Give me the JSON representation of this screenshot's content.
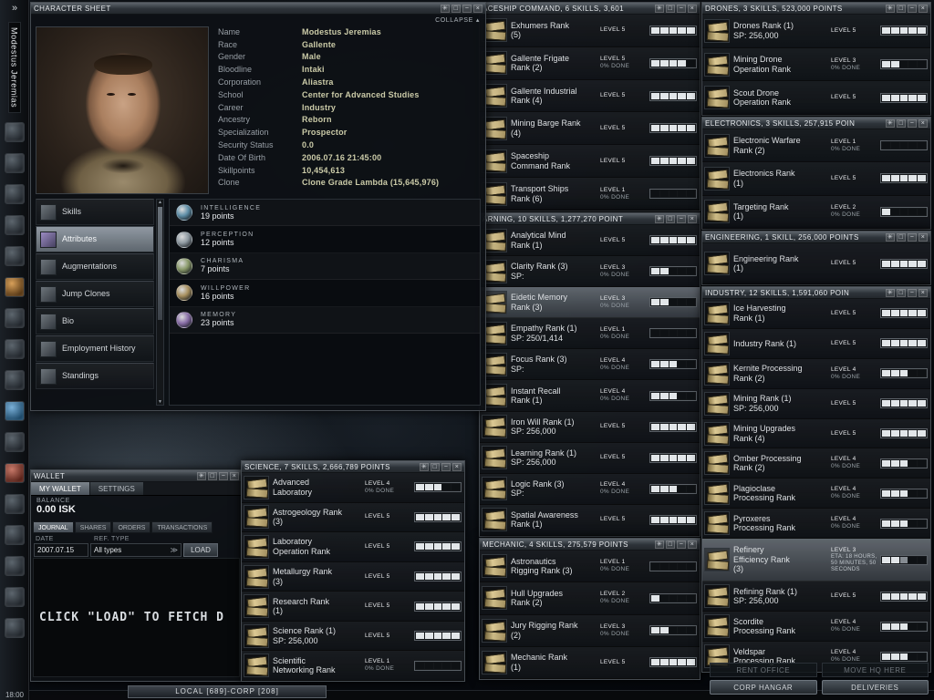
{
  "window_controls": [
    "✳",
    "□",
    "−",
    "×"
  ],
  "icons": {
    "collapse_arrow": "▴",
    "select_chevrons": "≫",
    "scroll_up": "▲",
    "scroll_down": "▼"
  },
  "sidebar": {
    "expander": "»",
    "character_name": "Modestus Jeremias",
    "time": "18:00",
    "icons": [
      "character",
      "map",
      "mail",
      "wallet",
      "market",
      "assets",
      "fitting",
      "cargo",
      "science",
      "corporation",
      "agents",
      "journal",
      "help",
      "settings",
      "people",
      "places",
      "log"
    ]
  },
  "character_sheet": {
    "title": "CHARACTER SHEET",
    "collapse_label": "COLLAPSE",
    "fields": [
      {
        "label": "Name",
        "value": "Modestus Jeremias"
      },
      {
        "label": "Race",
        "value": "Gallente"
      },
      {
        "label": "Gender",
        "value": "Male"
      },
      {
        "label": "Bloodline",
        "value": "Intaki"
      },
      {
        "label": "Corporation",
        "value": "Aliastra"
      },
      {
        "label": "School",
        "value": "Center for Advanced Studies"
      },
      {
        "label": "Career",
        "value": "Industry"
      },
      {
        "label": "Ancestry",
        "value": "Reborn"
      },
      {
        "label": "Specialization",
        "value": "Prospector"
      },
      {
        "label": "Security Status",
        "value": "0.0"
      },
      {
        "label": "Date Of Birth",
        "value": "2006.07.16 21:45:00"
      },
      {
        "label": "Skillpoints",
        "value": "10,454,613"
      },
      {
        "label": "Clone",
        "value": "Clone Grade Lambda (15,645,976)"
      }
    ],
    "nav": [
      {
        "label": "Skills",
        "selected": false
      },
      {
        "label": "Attributes",
        "selected": true
      },
      {
        "label": "Augmentations",
        "selected": false
      },
      {
        "label": "Jump Clones",
        "selected": false
      },
      {
        "label": "Bio",
        "selected": false
      },
      {
        "label": "Employment History",
        "selected": false
      },
      {
        "label": "Standings",
        "selected": false
      }
    ],
    "attributes": [
      {
        "name": "INTELLIGENCE",
        "points": "19 points",
        "icon_color": "#5f8fa8"
      },
      {
        "name": "PERCEPTION",
        "points": "12 points",
        "icon_color": "#8f9aa2"
      },
      {
        "name": "CHARISMA",
        "points": "7 points",
        "icon_color": "#8a9a6a"
      },
      {
        "name": "WILLPOWER",
        "points": "16 points",
        "icon_color": "#a8905f"
      },
      {
        "name": "MEMORY",
        "points": "23 points",
        "icon_color": "#8a6fa8"
      }
    ]
  },
  "skill_windows": [
    {
      "id": "spaceship",
      "title": "ACESHIP COMMAND, 6 SKILLS, 3,601",
      "skills": [
        {
          "lines": [
            "Exhumers Rank",
            "(5)"
          ],
          "level": "LEVEL 5",
          "done": "",
          "filled": 5
        },
        {
          "lines": [
            "Gallente Frigate",
            "Rank (2)"
          ],
          "level": "LEVEL 5",
          "done": "0% DONE",
          "filled": 4
        },
        {
          "lines": [
            "Gallente Industrial",
            "Rank (4)"
          ],
          "level": "LEVEL 5",
          "done": "",
          "filled": 5
        },
        {
          "lines": [
            "Mining Barge Rank",
            "(4)"
          ],
          "level": "LEVEL 5",
          "done": "",
          "filled": 5
        },
        {
          "lines": [
            "Spaceship",
            "Command Rank"
          ],
          "level": "LEVEL 5",
          "done": "",
          "filled": 5
        },
        {
          "lines": [
            "Transport Ships",
            "Rank (6)"
          ],
          "level": "LEVEL 1",
          "done": "0% DONE",
          "filled": 0
        }
      ]
    },
    {
      "id": "learning",
      "title": "ARNING, 10 SKILLS, 1,277,270 POINT",
      "skills": [
        {
          "lines": [
            "Analytical Mind",
            "Rank (1)"
          ],
          "level": "LEVEL 5",
          "done": "",
          "filled": 5
        },
        {
          "lines": [
            "Clarity Rank (3)",
            "SP:"
          ],
          "level": "LEVEL 3",
          "done": "0% DONE",
          "filled": 2
        },
        {
          "lines": [
            "Eidetic Memory",
            "Rank (3)"
          ],
          "level": "LEVEL 3",
          "done": "0% DONE",
          "filled": 2,
          "highlight": true
        },
        {
          "lines": [
            "Empathy Rank (1)",
            "SP: 250/1,414"
          ],
          "level": "LEVEL 1",
          "done": "0% DONE",
          "filled": 0
        },
        {
          "lines": [
            "Focus Rank (3)",
            "SP:"
          ],
          "level": "LEVEL 4",
          "done": "0% DONE",
          "filled": 3
        },
        {
          "lines": [
            "Instant Recall",
            "Rank (1)"
          ],
          "level": "LEVEL 4",
          "done": "0% DONE",
          "filled": 3
        },
        {
          "lines": [
            "Iron Will Rank (1)",
            "SP: 256,000"
          ],
          "level": "LEVEL 5",
          "done": "",
          "filled": 5
        },
        {
          "lines": [
            "Learning Rank (1)",
            "SP: 256,000"
          ],
          "level": "LEVEL 5",
          "done": "",
          "filled": 5
        },
        {
          "lines": [
            "Logic Rank (3)",
            "SP:"
          ],
          "level": "LEVEL 4",
          "done": "0% DONE",
          "filled": 3
        },
        {
          "lines": [
            "Spatial Awareness",
            "Rank (1)"
          ],
          "level": "LEVEL 5",
          "done": "",
          "filled": 5
        }
      ]
    },
    {
      "id": "mechanic",
      "title": "MECHANIC, 4 SKILLS, 275,579 POINTS",
      "skills": [
        {
          "lines": [
            "Astronautics",
            "Rigging Rank (3)"
          ],
          "level": "LEVEL 1",
          "done": "0% DONE",
          "filled": 0
        },
        {
          "lines": [
            "Hull Upgrades",
            "Rank (2)"
          ],
          "level": "LEVEL 2",
          "done": "0% DONE",
          "filled": 1
        },
        {
          "lines": [
            "Jury Rigging Rank",
            "(2)"
          ],
          "level": "LEVEL 3",
          "done": "0% DONE",
          "filled": 2
        },
        {
          "lines": [
            "Mechanic Rank",
            "(1)"
          ],
          "level": "LEVEL 5",
          "done": "",
          "filled": 5
        }
      ]
    },
    {
      "id": "science",
      "title": "SCIENCE, 7 SKILLS, 2,666,789 POINTS",
      "skills": [
        {
          "lines": [
            "Advanced",
            "Laboratory"
          ],
          "level": "LEVEL 4",
          "done": "0% DONE",
          "filled": 3
        },
        {
          "lines": [
            "Astrogeology Rank",
            "(3)"
          ],
          "level": "LEVEL 5",
          "done": "",
          "filled": 5
        },
        {
          "lines": [
            "Laboratory",
            "Operation Rank"
          ],
          "level": "LEVEL 5",
          "done": "",
          "filled": 5
        },
        {
          "lines": [
            "Metallurgy Rank",
            "(3)"
          ],
          "level": "LEVEL 5",
          "done": "",
          "filled": 5
        },
        {
          "lines": [
            "Research Rank",
            "(1)"
          ],
          "level": "LEVEL 5",
          "done": "",
          "filled": 5
        },
        {
          "lines": [
            "Science Rank (1)",
            "SP: 256,000"
          ],
          "level": "LEVEL 5",
          "done": "",
          "filled": 5
        },
        {
          "lines": [
            "Scientific",
            "Networking Rank"
          ],
          "level": "LEVEL 1",
          "done": "0% DONE",
          "filled": 0
        }
      ]
    },
    {
      "id": "drones",
      "title": "DRONES, 3 SKILLS, 523,000 POINTS",
      "skills": [
        {
          "lines": [
            "Drones Rank (1)",
            "SP: 256,000"
          ],
          "level": "LEVEL 5",
          "done": "",
          "filled": 5
        },
        {
          "lines": [
            "Mining Drone",
            "Operation Rank"
          ],
          "level": "LEVEL 3",
          "done": "0% DONE",
          "filled": 2
        },
        {
          "lines": [
            "Scout Drone",
            "Operation Rank"
          ],
          "level": "LEVEL 5",
          "done": "",
          "filled": 5
        }
      ]
    },
    {
      "id": "electronics",
      "title": "ELECTRONICS, 3 SKILLS, 257,915 POIN",
      "skills": [
        {
          "lines": [
            "Electronic Warfare",
            "Rank (2)"
          ],
          "level": "LEVEL 1",
          "done": "0% DONE",
          "filled": 0
        },
        {
          "lines": [
            "Electronics Rank",
            "(1)"
          ],
          "level": "LEVEL 5",
          "done": "",
          "filled": 5
        },
        {
          "lines": [
            "Targeting Rank",
            "(1)"
          ],
          "level": "LEVEL 2",
          "done": "0% DONE",
          "filled": 1
        }
      ]
    },
    {
      "id": "engineering",
      "title": "ENGINEERING, 1 SKILL, 256,000 POINTS",
      "skills": [
        {
          "lines": [
            "Engineering Rank",
            "(1)"
          ],
          "level": "LEVEL 5",
          "done": "",
          "filled": 5
        }
      ]
    },
    {
      "id": "industry",
      "title": "INDUSTRY, 12 SKILLS, 1,591,060 POIN",
      "skills": [
        {
          "lines": [
            "Ice Harvesting",
            "Rank (1)"
          ],
          "level": "LEVEL 5",
          "done": "",
          "filled": 5
        },
        {
          "lines": [
            "Industry Rank (1)"
          ],
          "level": "LEVEL 5",
          "done": "",
          "filled": 5
        },
        {
          "lines": [
            "Kernite Processing",
            "Rank (2)"
          ],
          "level": "LEVEL 4",
          "done": "0% DONE",
          "filled": 3
        },
        {
          "lines": [
            "Mining Rank (1)",
            "SP: 256,000"
          ],
          "level": "LEVEL 5",
          "done": "",
          "filled": 5
        },
        {
          "lines": [
            "Mining Upgrades",
            "Rank (4)"
          ],
          "level": "LEVEL 5",
          "done": "",
          "filled": 5
        },
        {
          "lines": [
            "Omber Processing",
            "Rank (2)"
          ],
          "level": "LEVEL 4",
          "done": "0% DONE",
          "filled": 3
        },
        {
          "lines": [
            "Plagioclase",
            "Processing Rank"
          ],
          "level": "LEVEL 4",
          "done": "0% DONE",
          "filled": 3
        },
        {
          "lines": [
            "Pyroxeres",
            "Processing Rank"
          ],
          "level": "LEVEL 4",
          "done": "0% DONE",
          "filled": 3
        },
        {
          "lines": [
            "Refinery",
            "Efficiency Rank",
            "(3)"
          ],
          "level": "LEVEL 3",
          "done": "",
          "eta": "ETA: 18 HOURS, 50 MINUTES, 50 SECONDS",
          "filled": 2,
          "partial": true,
          "highlight": true,
          "tall": true
        },
        {
          "lines": [
            "Refining Rank (1)",
            "SP: 256,000"
          ],
          "level": "LEVEL 5",
          "done": "",
          "filled": 5
        },
        {
          "lines": [
            "Scordite",
            "Processing Rank"
          ],
          "level": "LEVEL 4",
          "done": "0% DONE",
          "filled": 3
        },
        {
          "lines": [
            "Veldspar",
            "Processing Rank"
          ],
          "level": "LEVEL 4",
          "done": "0% DONE",
          "filled": 3
        }
      ]
    }
  ],
  "wallet": {
    "title": "WALLET",
    "tabs": [
      {
        "label": "MY WALLET",
        "selected": true
      },
      {
        "label": "SETTINGS",
        "selected": false
      }
    ],
    "balance_label": "BALANCE",
    "balance_value": "0.00 ISK",
    "subtabs": [
      {
        "label": "JOURNAL",
        "selected": true
      },
      {
        "label": "SHARES",
        "selected": false
      },
      {
        "label": "ORDERS",
        "selected": false
      },
      {
        "label": "TRANSACTIONS",
        "selected": false
      }
    ],
    "filter": {
      "date_label": "DATE",
      "type_label": "REF. TYPE",
      "date_value": "2007.07.15",
      "type_value": "All types",
      "load_label": "LOAD"
    },
    "message": "CLICK \"LOAD\" TO FETCH D"
  },
  "station_panel": {
    "buttons": [
      "RENT OFFICE",
      "MOVE HQ HERE",
      "CORP HANGAR",
      "DELIVERIES"
    ]
  },
  "chat_tab": {
    "label": "LOCAL [689]-CORP [208]"
  }
}
